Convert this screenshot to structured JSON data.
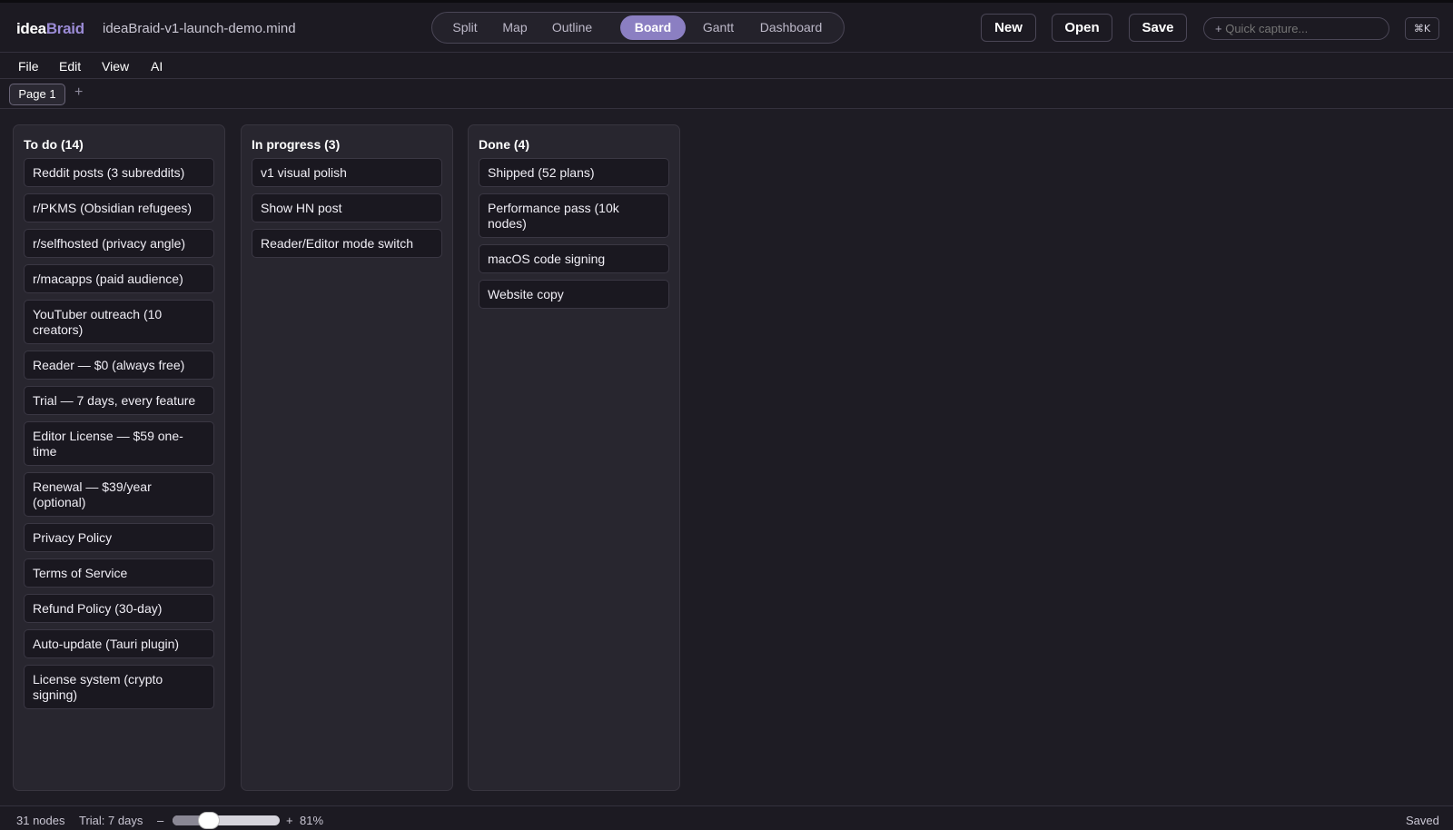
{
  "app": {
    "logo_part1": "idea",
    "logo_part2": "Braid",
    "filename": "ideaBraid-v1-launch-demo.mind"
  },
  "view_tabs": [
    {
      "label": "Split",
      "active": false
    },
    {
      "label": "Map",
      "active": false
    },
    {
      "label": "Outline",
      "active": false
    },
    {
      "label": "Board",
      "active": true
    },
    {
      "label": "Gantt",
      "active": false
    },
    {
      "label": "Dashboard",
      "active": false
    }
  ],
  "toolbar": {
    "new_label": "New",
    "open_label": "Open",
    "save_label": "Save",
    "capture_icon": "+",
    "capture_placeholder": "Quick capture...",
    "shortcut": "⌘K"
  },
  "menu": [
    "File",
    "Edit",
    "View",
    "AI"
  ],
  "pages": {
    "tabs": [
      "Page 1"
    ],
    "add_label": "+"
  },
  "board": {
    "columns": [
      {
        "title": "To do (14)",
        "cards": [
          "Reddit posts (3 subreddits)",
          "r/PKMS (Obsidian refugees)",
          "r/selfhosted (privacy angle)",
          "r/macapps (paid audience)",
          "YouTuber outreach (10 creators)",
          "Reader — $0 (always free)",
          "Trial — 7 days, every feature",
          "Editor License — $59 one-time",
          "Renewal — $39/year (optional)",
          "Privacy Policy",
          "Terms of Service",
          "Refund Policy (30-day)",
          "Auto-update (Tauri plugin)",
          "License system (crypto signing)"
        ]
      },
      {
        "title": "In progress (3)",
        "cards": [
          "v1 visual polish",
          "Show HN post",
          "Reader/Editor mode switch"
        ]
      },
      {
        "title": "Done (4)",
        "cards": [
          "Shipped (52 plans)",
          "Performance pass (10k nodes)",
          "macOS code signing",
          "Website copy"
        ]
      }
    ]
  },
  "status": {
    "nodes": "31 nodes",
    "trial": "Trial: 7 days",
    "zoom_minus": "–",
    "zoom_plus": "+",
    "zoom_level": "81%",
    "zoom_fraction": 0.3,
    "save_state": "Saved"
  },
  "colors": {
    "accent": "#8b7fc2",
    "background": "#1e1c24",
    "column": "#28262f",
    "card": "#1a1820"
  }
}
